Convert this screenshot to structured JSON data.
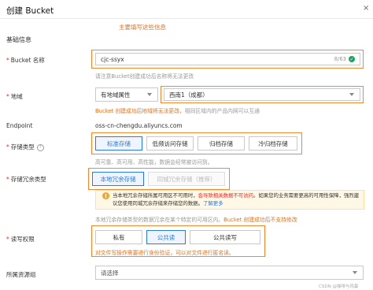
{
  "header": {
    "title": "创建 Bucket",
    "close_icon": "×"
  },
  "annotation_top": "主要填写这些信息",
  "section_basic": "基础信息",
  "bucket_name": {
    "label": "Bucket 名称",
    "value": "cjc-ssyx",
    "counter": "8/63",
    "help": "请注意Bucket创建成功后名称将无法更改"
  },
  "region": {
    "label": "地域",
    "type_value": "有地域属性",
    "region_value": "西南1（成都）",
    "help_prefix": "Bucket 创建成功后地域将无法更改，",
    "help_suffix": "相同区域内的产品内网可以互通"
  },
  "endpoint": {
    "label": "Endpoint",
    "value": "oss-cn-chengdu.aliyuncs.com"
  },
  "storage_class": {
    "label": "存储类型",
    "options": [
      "标准存储",
      "低频访问存储",
      "归档存储",
      "冷归档存储"
    ],
    "selected": "标准存储",
    "help": "高可靠、高可用、高性能，数据会经常被访问到。"
  },
  "redundancy": {
    "label": "存储冗余类型",
    "options": [
      "本地冗余存储",
      "同城冗余存储（推荐）"
    ],
    "selected": "本地冗余存储",
    "warning_prefix": "当本地冗余存储所属可用区不可用时，",
    "warning_highlight": "会导致相关数据不可访问",
    "warning_suffix": "。如果您的业务需要更高的可用性保障，强烈建议您使用同城冗余存储来存储您的数据。",
    "warning_link": "了解更多",
    "help_prefix": "本地冗余存储类型的数据冗余在某个特定的可用区内。",
    "help_highlight": "Bucket 创建成功后不支持修改"
  },
  "acl": {
    "label": "读写权限",
    "options": [
      "私有",
      "公共读",
      "公共读写"
    ],
    "selected": "公共读",
    "help": "对文件写操作需要进行身份验证，可以对文件进行匿名读。"
  },
  "resource_group": {
    "label": "所属资源组",
    "placeholder": "请选择"
  },
  "watermark": "CSDN @咖啡与鸡蛋",
  "colors": {
    "accent": "#2a7ae2",
    "annotation": "#ef8b2d",
    "required": "#e02e24",
    "success": "#20a162"
  }
}
